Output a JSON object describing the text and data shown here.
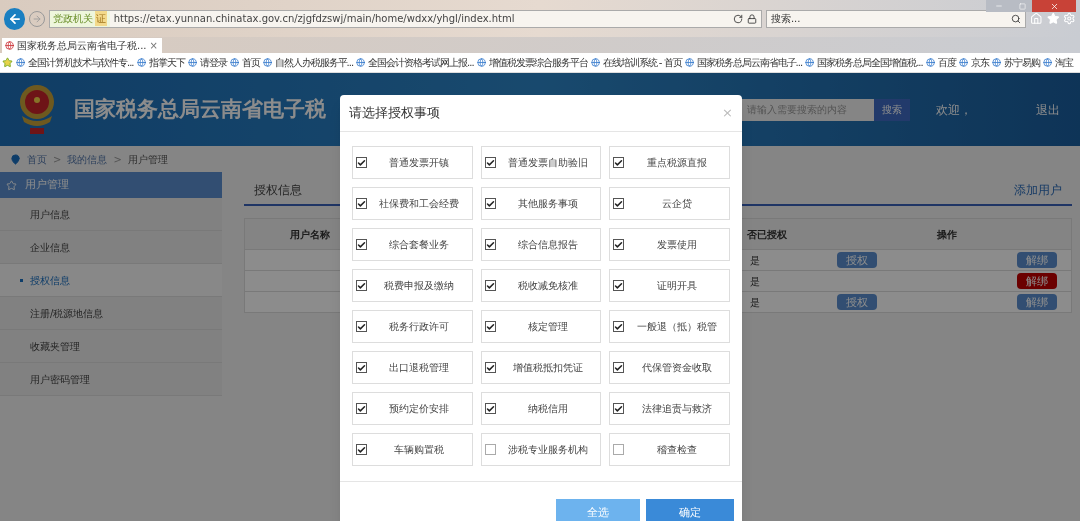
{
  "browser": {
    "url": "https://etax.yunnan.chinatax.gov.cn/zjgfdzswj/main/home/wdxx/yhgl/index.html",
    "address_badge": {
      "label": "党政机关",
      "mark": "证"
    },
    "search_placeholder": "搜索...",
    "tab": {
      "title": "国家税务总局云南省电子税...",
      "close": "×"
    },
    "favorites": [
      "全国计算机技术与软件专...",
      "指掌天下",
      "请登录",
      "首页",
      "自然人办税服务平...",
      "全国会计资格考试网上报...",
      "增值税发票综合服务平台",
      "在线培训系统 - 首页",
      "国家税务总局云南省电子...",
      "国家税务总局全国增值税...",
      "百度",
      "京东",
      "苏宁易购",
      "淘宝"
    ]
  },
  "header": {
    "title": "国家税务总局云南省电子税",
    "search_placeholder": "请输入需要搜索的内容",
    "search_button": "搜索",
    "welcome": "欢迎，",
    "logout": "退出"
  },
  "breadcrumb": {
    "items": [
      "首页",
      "我的信息",
      "用户管理"
    ],
    "separator": ">"
  },
  "sidebar": {
    "heading": "用户管理",
    "items": [
      {
        "label": "用户信息",
        "selected": false
      },
      {
        "label": "企业信息",
        "selected": false
      },
      {
        "label": "授权信息",
        "selected": true
      },
      {
        "label": "注册/税源地信息",
        "selected": false
      },
      {
        "label": "收藏夹管理",
        "selected": false
      },
      {
        "label": "用户密码管理",
        "selected": false
      }
    ]
  },
  "content": {
    "tab": "授权信息",
    "add_user": "添加用户",
    "columns": [
      "用户名称",
      "否已授权",
      "操作"
    ],
    "rows": [
      {
        "authorized": "是",
        "actions": [
          {
            "label": "授权",
            "kind": "grant"
          },
          {
            "label": "解绑",
            "kind": "unbind"
          }
        ]
      },
      {
        "authorized": "是",
        "actions": [
          {
            "label": "解绑",
            "kind": "danger"
          }
        ]
      },
      {
        "authorized": "是",
        "actions": [
          {
            "label": "授权",
            "kind": "grant"
          },
          {
            "label": "解绑",
            "kind": "unbind"
          }
        ]
      }
    ]
  },
  "dialog": {
    "title": "请选择授权事项",
    "close": "×",
    "options": [
      {
        "label": "普通发票开镇",
        "checked": true
      },
      {
        "label": "普通发票自助验旧",
        "checked": true
      },
      {
        "label": "重点税源直报",
        "checked": true
      },
      {
        "label": "社保费和工会经费",
        "checked": true
      },
      {
        "label": "其他服务事项",
        "checked": true
      },
      {
        "label": "云企贷",
        "checked": true
      },
      {
        "label": "综合套餐业务",
        "checked": true
      },
      {
        "label": "综合信息报告",
        "checked": true
      },
      {
        "label": "发票使用",
        "checked": true
      },
      {
        "label": "税费申报及缴纳",
        "checked": true
      },
      {
        "label": "税收减免核准",
        "checked": true
      },
      {
        "label": "证明开具",
        "checked": true
      },
      {
        "label": "税务行政许可",
        "checked": true
      },
      {
        "label": "核定管理",
        "checked": true
      },
      {
        "label": "一般退（抵）税管",
        "checked": true
      },
      {
        "label": "出口退税管理",
        "checked": true
      },
      {
        "label": "增值税抵扣凭证",
        "checked": true
      },
      {
        "label": "代保管资金收取",
        "checked": true
      },
      {
        "label": "预约定价安排",
        "checked": true
      },
      {
        "label": "纳税信用",
        "checked": true
      },
      {
        "label": "法律追责与救济",
        "checked": true
      },
      {
        "label": "车辆购置税",
        "checked": true
      },
      {
        "label": "涉税专业服务机构",
        "checked": false
      },
      {
        "label": "稽查检查",
        "checked": false
      }
    ],
    "buttons": [
      {
        "label": "全选",
        "kind": "secondary"
      },
      {
        "label": "确定",
        "kind": "primary"
      }
    ]
  }
}
